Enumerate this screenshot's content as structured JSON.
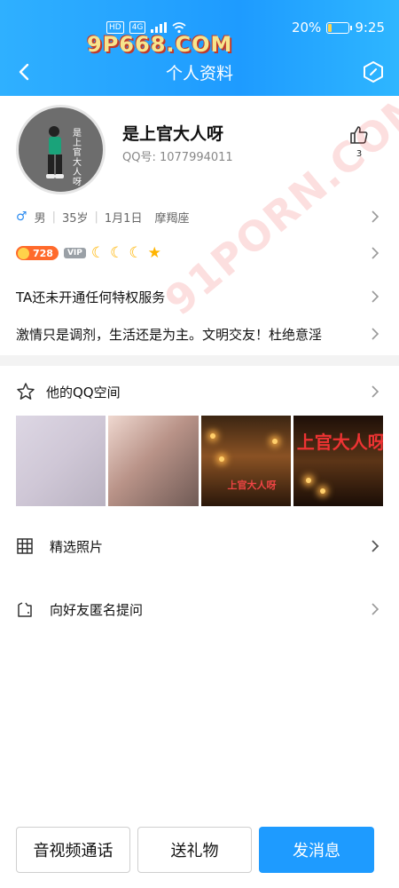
{
  "statusbar": {
    "left_badges": [
      "HD",
      "4G"
    ],
    "battery_text": "20%",
    "battery_level": 0.2,
    "time": "9:25"
  },
  "watermark": {
    "top": "9P668.COM",
    "diagonal": "91PORN.COM"
  },
  "nav": {
    "title": "个人资料"
  },
  "profile": {
    "name": "是上官大人呀",
    "qq_label": "QQ号: ",
    "qq_number": "1077994011",
    "like_count": "3",
    "avatar_text": "是上官大人呀"
  },
  "info": {
    "gender_symbol": "♂",
    "gender": "男",
    "age": "35岁",
    "birthday": "1月1日",
    "zodiac": "摩羯座"
  },
  "badges": {
    "coins": "728",
    "vip": "VIP",
    "moons": [
      "☾",
      "☾",
      "☾"
    ],
    "star": "★"
  },
  "rows": {
    "privilege": "TA还未开通任何特权服务",
    "signature": "激情只是调剂，生活还是为主。文明交友！杜绝意淫"
  },
  "qzone": {
    "title": "他的QQ空间",
    "photo_overlays": [
      "",
      "",
      "上官大人呀",
      "上官大人呀"
    ]
  },
  "menu": {
    "featured_photos": "精选照片",
    "anonymous_question": "向好友匿名提问"
  },
  "bottom": {
    "call": "音视频通话",
    "gift": "送礼物",
    "message": "发消息"
  },
  "colors": {
    "header": "#1e9bff",
    "primary": "#1e9bff",
    "coin": "#ff6a2b"
  },
  "icons": [
    "back-arrow-icon",
    "settings-hexagon-icon",
    "thumbs-up-icon",
    "male-icon",
    "chevron-right-icon",
    "star-outline-icon",
    "grid-icon",
    "question-bag-icon"
  ]
}
